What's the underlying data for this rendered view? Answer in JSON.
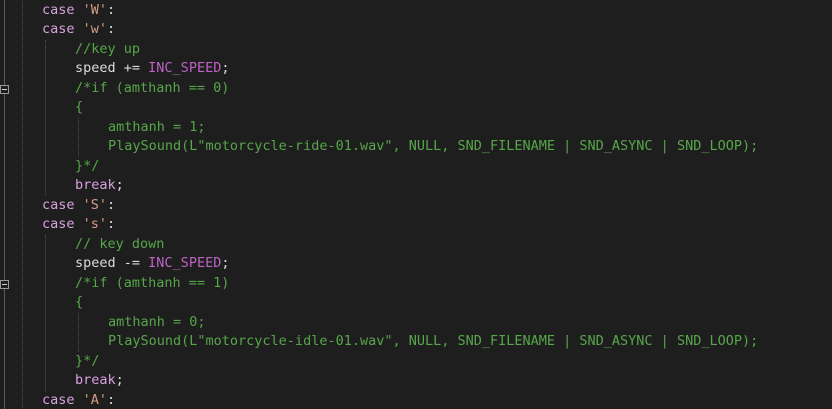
{
  "code_lines": [
    {
      "indent": 0,
      "tokens": [
        {
          "t": "case ",
          "c": "kw"
        },
        {
          "t": "'W'",
          "c": "str"
        },
        {
          "t": ":",
          "c": "txt"
        }
      ]
    },
    {
      "indent": 0,
      "tokens": [
        {
          "t": "case ",
          "c": "kw"
        },
        {
          "t": "'w'",
          "c": "str"
        },
        {
          "t": ":",
          "c": "txt"
        }
      ]
    },
    {
      "indent": 1,
      "tokens": [
        {
          "t": "//key up",
          "c": "cmt"
        }
      ]
    },
    {
      "indent": 1,
      "tokens": [
        {
          "t": "speed ",
          "c": "txt"
        },
        {
          "t": "+=",
          "c": "txt"
        },
        {
          "t": " INC_SPEED",
          "c": "macro"
        },
        {
          "t": ";",
          "c": "txt"
        }
      ]
    },
    {
      "indent": 1,
      "tokens": [
        {
          "t": "/*if (amthanh == 0)",
          "c": "cmt"
        }
      ]
    },
    {
      "indent": 1,
      "tokens": [
        {
          "t": "{",
          "c": "cmt"
        }
      ]
    },
    {
      "indent": 2,
      "tokens": [
        {
          "t": "amthanh = 1;",
          "c": "cmt"
        }
      ]
    },
    {
      "indent": 2,
      "tokens": [
        {
          "t": "PlaySound(L\"motorcycle-ride-01.wav\", NULL, SND_FILENAME | SND_ASYNC | SND_LOOP);",
          "c": "cmt"
        }
      ]
    },
    {
      "indent": 1,
      "tokens": [
        {
          "t": "}*/",
          "c": "cmt"
        }
      ]
    },
    {
      "indent": 1,
      "tokens": [
        {
          "t": "break",
          "c": "kw"
        },
        {
          "t": ";",
          "c": "txt"
        }
      ]
    },
    {
      "indent": 0,
      "tokens": [
        {
          "t": "case ",
          "c": "kw"
        },
        {
          "t": "'S'",
          "c": "str"
        },
        {
          "t": ":",
          "c": "txt"
        }
      ]
    },
    {
      "indent": 0,
      "tokens": [
        {
          "t": "case ",
          "c": "kw"
        },
        {
          "t": "'s'",
          "c": "str"
        },
        {
          "t": ":",
          "c": "txt"
        }
      ]
    },
    {
      "indent": 1,
      "tokens": [
        {
          "t": "// key down",
          "c": "cmt"
        }
      ]
    },
    {
      "indent": 1,
      "tokens": [
        {
          "t": "speed ",
          "c": "txt"
        },
        {
          "t": "-=",
          "c": "txt"
        },
        {
          "t": " INC_SPEED",
          "c": "macro"
        },
        {
          "t": ";",
          "c": "txt"
        }
      ]
    },
    {
      "indent": 1,
      "tokens": [
        {
          "t": "/*if (amthanh == 1)",
          "c": "cmt"
        }
      ]
    },
    {
      "indent": 1,
      "tokens": [
        {
          "t": "{",
          "c": "cmt"
        }
      ]
    },
    {
      "indent": 2,
      "tokens": [
        {
          "t": "amthanh = 0;",
          "c": "cmt"
        }
      ]
    },
    {
      "indent": 2,
      "tokens": [
        {
          "t": "PlaySound(L\"motorcycle-idle-01.wav\", NULL, SND_FILENAME | SND_ASYNC | SND_LOOP);",
          "c": "cmt"
        }
      ]
    },
    {
      "indent": 1,
      "tokens": [
        {
          "t": "}*/",
          "c": "cmt"
        }
      ]
    },
    {
      "indent": 1,
      "tokens": [
        {
          "t": "break",
          "c": "kw"
        },
        {
          "t": ";",
          "c": "txt"
        }
      ]
    },
    {
      "indent": 0,
      "tokens": [
        {
          "t": "case ",
          "c": "kw"
        },
        {
          "t": "'A'",
          "c": "str"
        },
        {
          "t": ":",
          "c": "txt"
        }
      ]
    }
  ],
  "fold_markers": [
    {
      "line_index": 4,
      "icon": "collapse-icon"
    },
    {
      "line_index": 14,
      "icon": "collapse-icon"
    }
  ],
  "colors": {
    "background": "#1e1e1e",
    "keyword": "#d8a0df",
    "string": "#d69d85",
    "comment": "#57a64a",
    "macro": "#bd63c5",
    "text": "#dcdcdc"
  }
}
